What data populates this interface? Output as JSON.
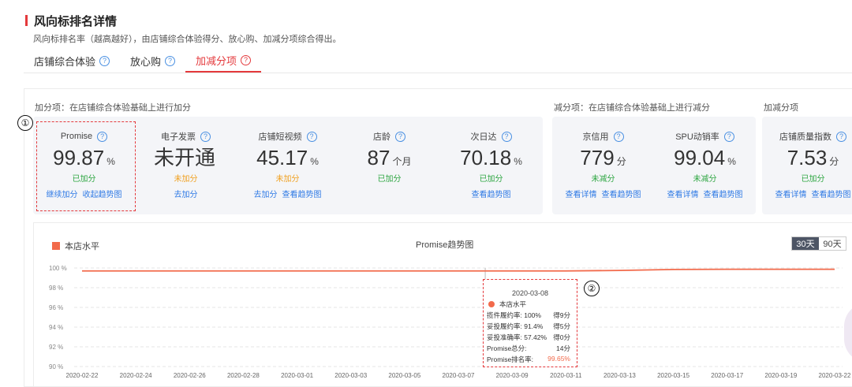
{
  "header": {
    "title": "风向标排名详情",
    "subtitle": "风向标排名率（越高越好），由店铺综合体验得分、放心购、加减分项综合得出。"
  },
  "tabs": [
    {
      "label": "店铺综合体验",
      "active": false
    },
    {
      "label": "放心购",
      "active": false
    },
    {
      "label": "加减分项",
      "active": true
    }
  ],
  "sections": {
    "add": "加分项：在店铺综合体验基础上进行加分",
    "subtract": "减分项：在店铺综合体验基础上进行减分",
    "addsub": "加减分项"
  },
  "add_cards": [
    {
      "name": "Promise",
      "value": "99.87",
      "unit": "%",
      "status": "已加分",
      "status_color": "green",
      "links": [
        "继续加分",
        "收起趋势图"
      ]
    },
    {
      "name": "电子发票",
      "value": "未开通",
      "unit": "",
      "status": "未加分",
      "status_color": "orange",
      "links": [
        "去加分"
      ]
    },
    {
      "name": "店铺短视频",
      "value": "45.17",
      "unit": "%",
      "status": "未加分",
      "status_color": "orange",
      "links": [
        "去加分",
        "查看趋势图"
      ]
    },
    {
      "name": "店龄",
      "value": "87",
      "unit": "个月",
      "status": "已加分",
      "status_color": "green",
      "links": []
    },
    {
      "name": "次日达",
      "value": "70.18",
      "unit": "%",
      "status": "已加分",
      "status_color": "green",
      "links": [
        "查看趋势图"
      ]
    }
  ],
  "sub_cards": [
    {
      "name": "京信用",
      "value": "779",
      "unit": "分",
      "status": "未减分",
      "status_color": "green",
      "links": [
        "查看详情",
        "查看趋势图"
      ]
    },
    {
      "name": "SPU动销率",
      "value": "99.04",
      "unit": "%",
      "status": "未减分",
      "status_color": "green",
      "links": [
        "查看详情",
        "查看趋势图"
      ]
    }
  ],
  "addsub_cards": [
    {
      "name": "店铺质量指数",
      "value": "7.53",
      "unit": "分",
      "status": "已加分",
      "status_color": "green",
      "links": [
        "查看详情",
        "查看趋势图"
      ]
    }
  ],
  "annotations": {
    "one": "①",
    "two": "②"
  },
  "chart": {
    "legend": "本店水平",
    "title": "Promise趋势图",
    "range_30": "30天",
    "range_90": "90天",
    "line_color": "#f26a4b"
  },
  "chart_data": {
    "type": "line",
    "title": "Promise趋势图",
    "x": [
      "2020-02-22",
      "2020-02-24",
      "2020-02-26",
      "2020-02-28",
      "2020-03-01",
      "2020-03-03",
      "2020-03-05",
      "2020-03-07",
      "2020-03-09",
      "2020-03-11",
      "2020-03-13",
      "2020-03-15",
      "2020-03-17",
      "2020-03-19",
      "2020-03-22"
    ],
    "series": [
      {
        "name": "本店水平",
        "values": [
          99.7,
          99.7,
          99.7,
          99.7,
          99.7,
          99.7,
          99.7,
          99.7,
          99.7,
          99.7,
          99.75,
          99.85,
          99.87,
          99.87,
          99.87
        ]
      }
    ],
    "yticks": [
      "100 %",
      "98 %",
      "96 %",
      "94 %",
      "92 %",
      "90 %"
    ],
    "ylim": [
      90,
      100
    ],
    "grid": true,
    "legend_position": "top-left"
  },
  "tooltip": {
    "date": "2020-03-08",
    "legend": "本店水平",
    "rows": [
      {
        "label": "揽件履约率: 100%",
        "value": "得9分",
        "red": false
      },
      {
        "label": "妥投履约率: 91.4%",
        "value": "得5分",
        "red": false
      },
      {
        "label": "妥投准确率: 57.42%",
        "value": "得0分",
        "red": false
      },
      {
        "label": "Promise总分:",
        "value": "14分",
        "red": false
      },
      {
        "label": "Promise排名率:",
        "value": "99.65%",
        "red": true
      }
    ]
  }
}
